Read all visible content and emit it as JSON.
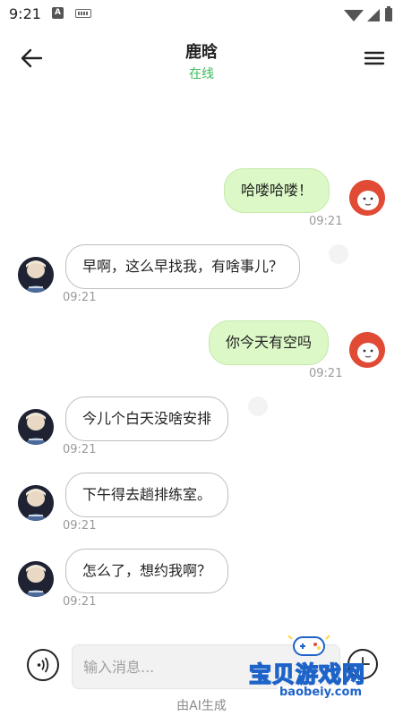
{
  "status_bar": {
    "time": "9:21",
    "a_badge": "A"
  },
  "header": {
    "name": "鹿晗",
    "status": "在线"
  },
  "messages": [
    {
      "side": "sent",
      "text": "哈喽哈喽！",
      "time": "09:21"
    },
    {
      "side": "recv",
      "text": "早啊，这么早找我，有啥事儿？",
      "time": "09:21"
    },
    {
      "side": "sent",
      "text": "你今天有空吗",
      "time": "09:21"
    },
    {
      "side": "recv",
      "text": "今儿个白天没啥安排",
      "time": "09:21"
    },
    {
      "side": "recv",
      "text": "下午得去趟排练室。",
      "time": "09:21"
    },
    {
      "side": "recv",
      "text": "怎么了，想约我啊？",
      "time": "09:21"
    }
  ],
  "input": {
    "placeholder": "输入消息..."
  },
  "footer": {
    "note": "由AI生成"
  },
  "watermark": {
    "text": "宝贝游戏网",
    "url": "baobeiy.com"
  },
  "colors": {
    "online": "#3cb95a",
    "sent_bubble": "#dcf8c6",
    "recv_border": "#bdbdbd"
  },
  "icons": [
    "back-arrow-icon",
    "menu-icon",
    "voice-icon",
    "plus-icon",
    "speaker-icon"
  ]
}
